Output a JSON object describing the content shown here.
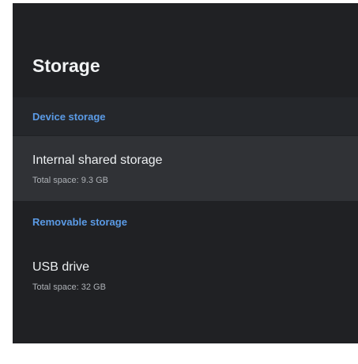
{
  "page": {
    "title": "Storage"
  },
  "device_storage": {
    "header": "Device storage",
    "items": [
      {
        "title": "Internal shared storage",
        "subtitle": "Total space: 9.3 GB"
      }
    ]
  },
  "removable_storage": {
    "header": "Removable storage",
    "items": [
      {
        "title": "USB drive",
        "subtitle": "Total space: 32 GB"
      }
    ]
  },
  "colors": {
    "background": "#202124",
    "accent": "#5b9be6",
    "selected_row": "#303236"
  }
}
